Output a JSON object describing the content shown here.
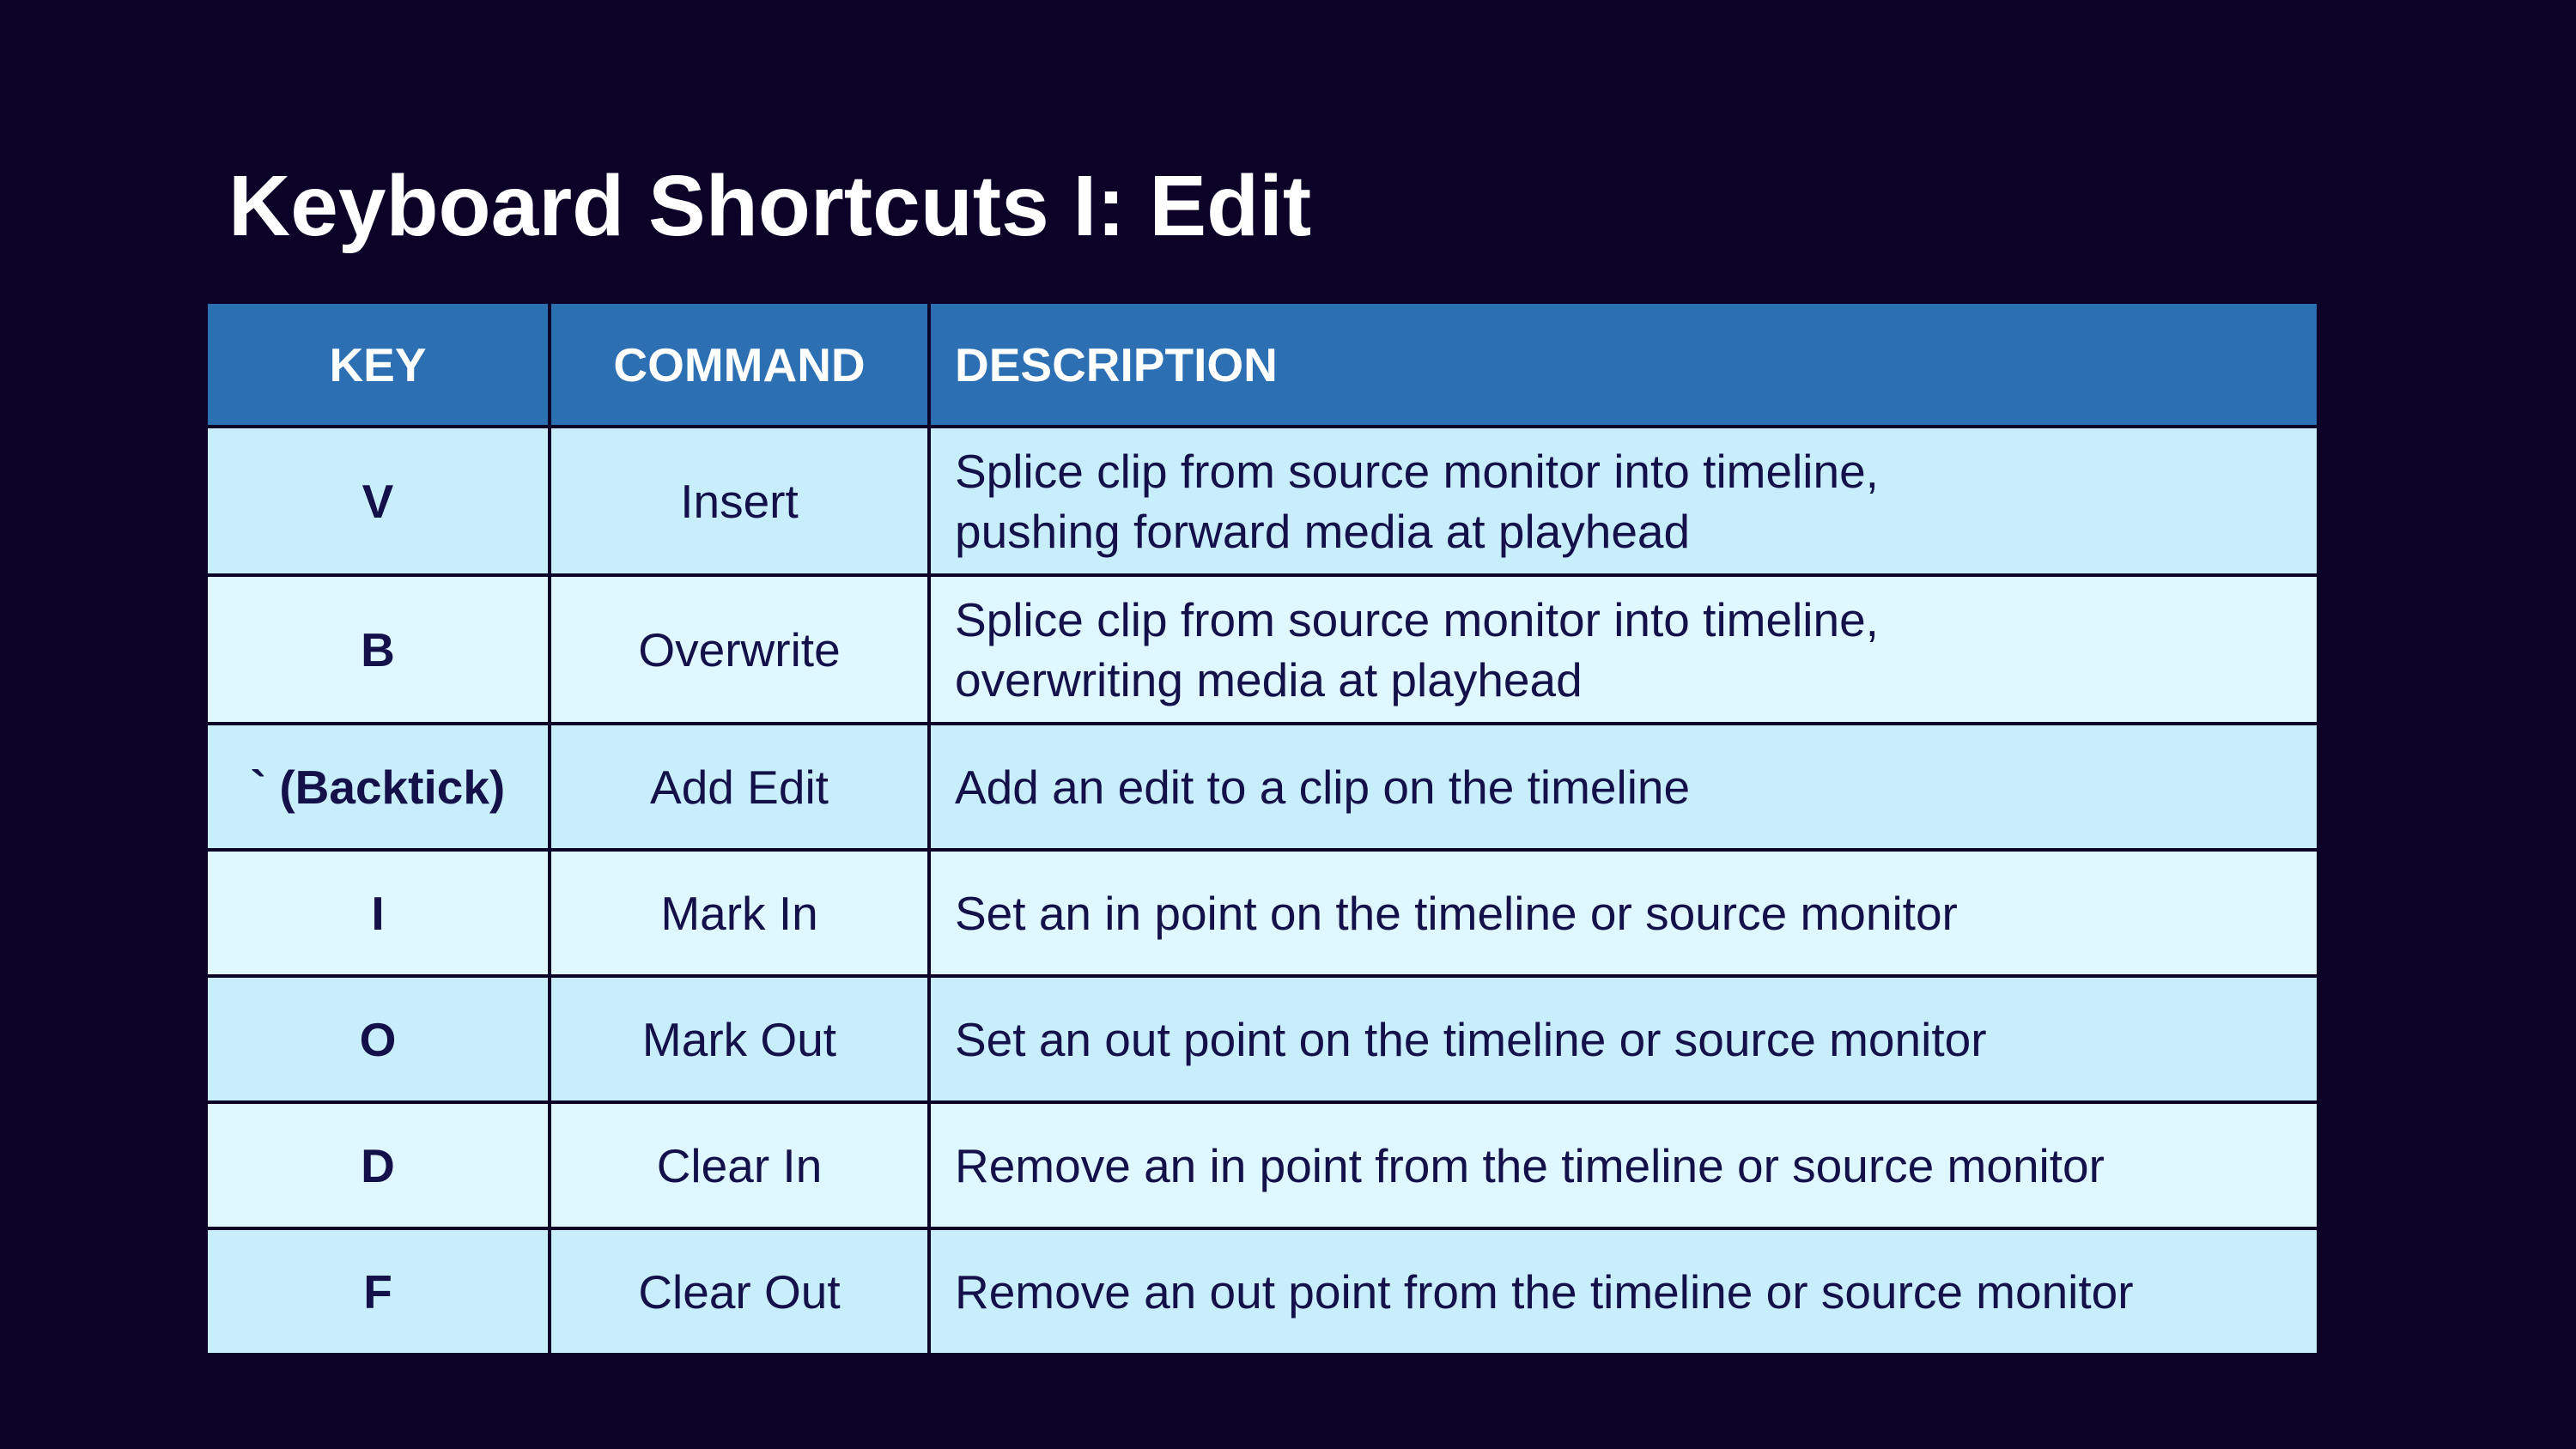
{
  "title": "Keyboard Shortcuts I: Edit",
  "table": {
    "headers": {
      "key": "KEY",
      "command": "COMMAND",
      "description": "DESCRIPTION"
    },
    "rows": [
      {
        "key": "V",
        "command": "Insert",
        "description": [
          "Splice clip from source monitor into timeline,",
          "pushing forward media at playhead"
        ]
      },
      {
        "key": "B",
        "command": "Overwrite",
        "description": [
          "Splice clip from source monitor into timeline,",
          "overwriting media at playhead"
        ]
      },
      {
        "key": "` (Backtick)",
        "command": "Add Edit",
        "description": [
          "Add an edit to a clip on the timeline"
        ]
      },
      {
        "key": "I",
        "command": "Mark In",
        "description": [
          "Set an in point on the timeline or source monitor"
        ]
      },
      {
        "key": "O",
        "command": "Mark Out",
        "description": [
          "Set an out point on the timeline or source monitor"
        ]
      },
      {
        "key": "D",
        "command": "Clear In",
        "description": [
          "Remove an in point from the timeline or source monitor"
        ]
      },
      {
        "key": "F",
        "command": "Clear Out",
        "description": [
          "Remove an out point from the timeline or source monitor"
        ]
      }
    ]
  },
  "colors": {
    "background": "#0c0126",
    "header_fill": "#2c6fb3",
    "row_fill_odd": "#c9eefb",
    "row_fill_even": "#dff8ff",
    "cell_text": "#14104a",
    "title_text": "#ffffff"
  }
}
